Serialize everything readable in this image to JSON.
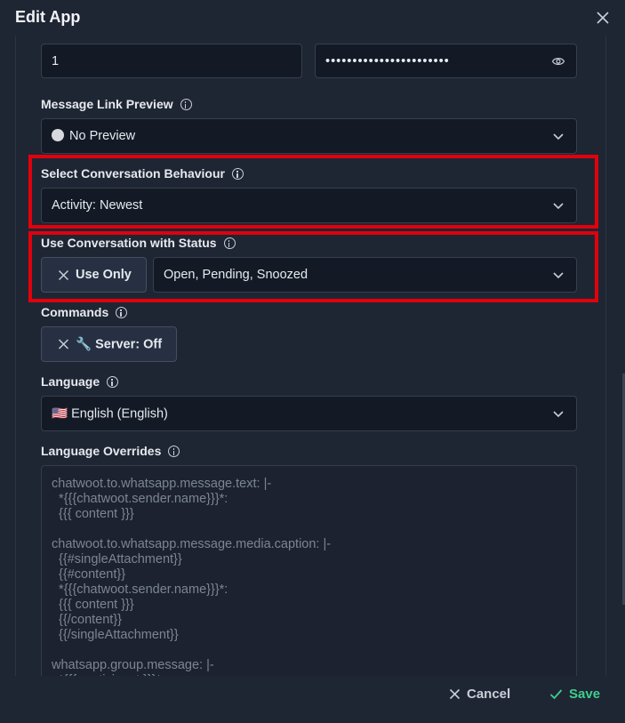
{
  "dialog": {
    "title": "Edit App"
  },
  "top_fields": {
    "number_value": "1",
    "secret_value": "•••••••••••••••••••••••"
  },
  "message_link_preview": {
    "label": "Message Link Preview",
    "value": "No Preview"
  },
  "conversation_behaviour": {
    "label": "Select Conversation Behaviour",
    "value": "Activity: Newest"
  },
  "conversation_status": {
    "label": "Use Conversation with Status",
    "toggle_label": "Use Only",
    "value": "Open, Pending, Snoozed"
  },
  "commands": {
    "label": "Commands",
    "chip_label": "🔧 Server: Off"
  },
  "language": {
    "label": "Language",
    "value": "🇺🇸 English (English)"
  },
  "language_overrides": {
    "label": "Language Overrides",
    "text": "chatwoot.to.whatsapp.message.text: |-\n  *{{{chatwoot.sender.name}}}*:\n  {{{ content }}}\n\nchatwoot.to.whatsapp.message.media.caption: |-\n  {{#singleAttachment}}\n  {{#content}}\n  *{{{chatwoot.sender.name}}}*:\n  {{{ content }}}\n  {{/content}}\n  {{/singleAttachment}}\n\nwhatsapp.group.message: |-\n  *{{{ participant }}}*:"
  },
  "footer": {
    "cancel_label": "Cancel",
    "save_label": "Save"
  },
  "colors": {
    "highlight": "#e1000b",
    "save": "#3ecf8e",
    "background": "#1f2633"
  }
}
